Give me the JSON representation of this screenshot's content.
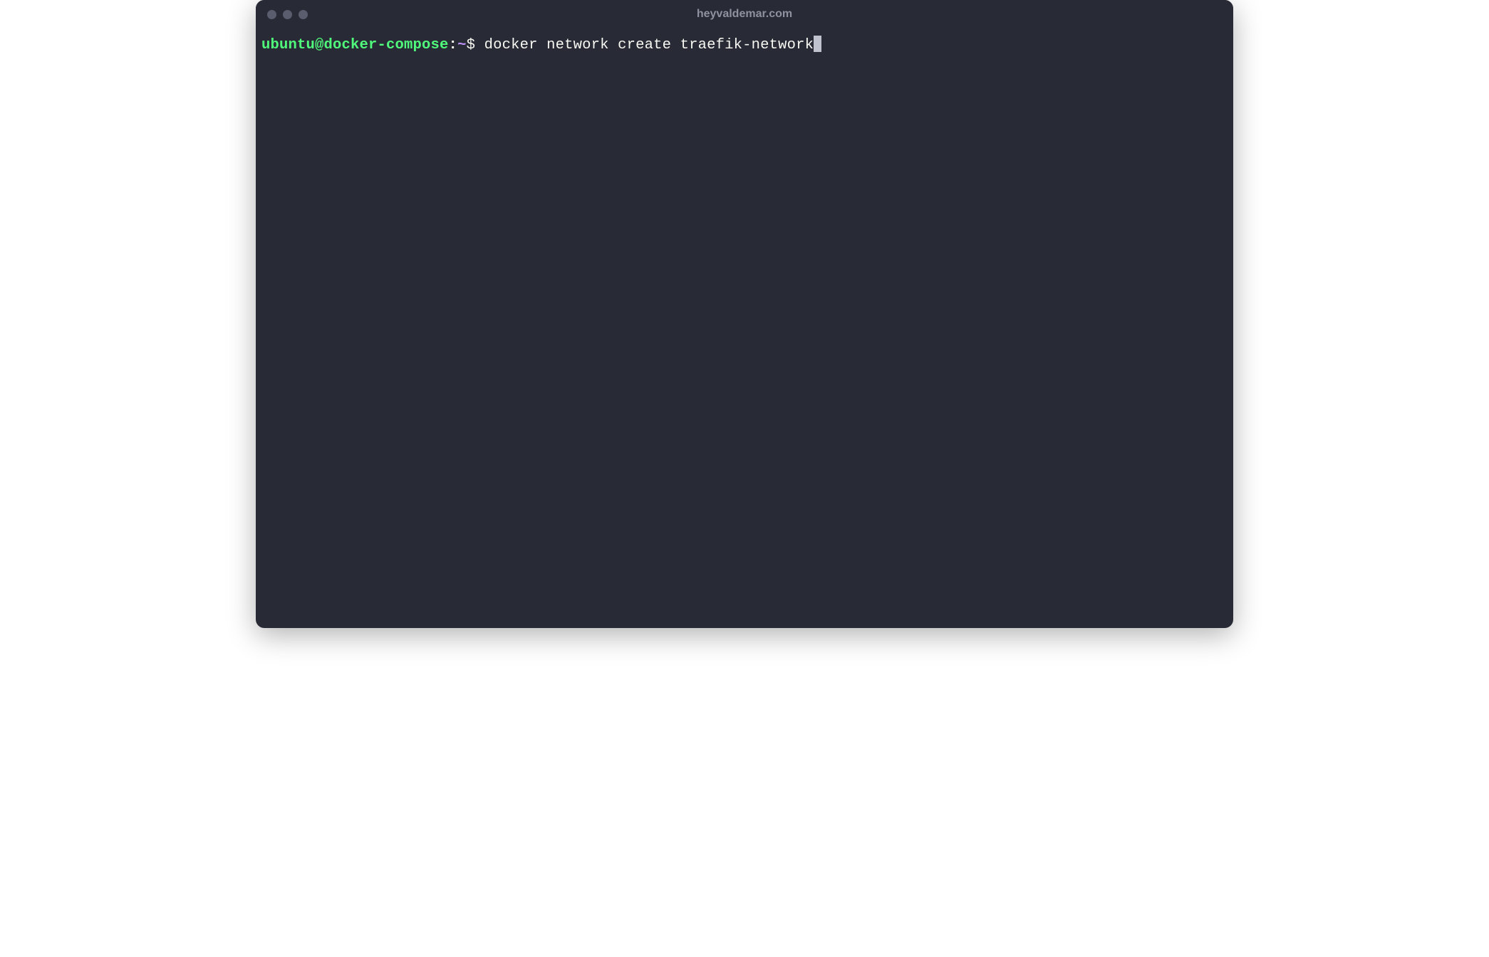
{
  "window": {
    "title": "heyvaldemar.com"
  },
  "terminal": {
    "prompt": {
      "user_host": "ubuntu@docker-compose",
      "colon": ":",
      "path": "~",
      "symbol": "$ "
    },
    "command": "docker network create traefik-network"
  }
}
